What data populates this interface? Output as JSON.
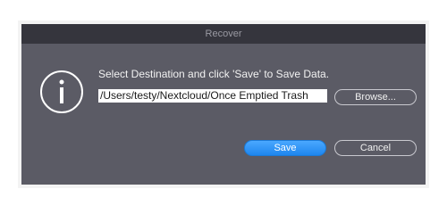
{
  "dialog": {
    "title": "Recover",
    "icon": "info-icon",
    "message": "Select Destination and click 'Save' to Save Data.",
    "path_value": "/Users/testy/Nextcloud/Once Emptied Trash",
    "browse_label": "Browse...",
    "save_label": "Save",
    "cancel_label": "Cancel"
  },
  "colors": {
    "dialog_bg": "#5b5b65",
    "titlebar_bg": "#35353d",
    "primary_button": "#2b8ff5"
  }
}
